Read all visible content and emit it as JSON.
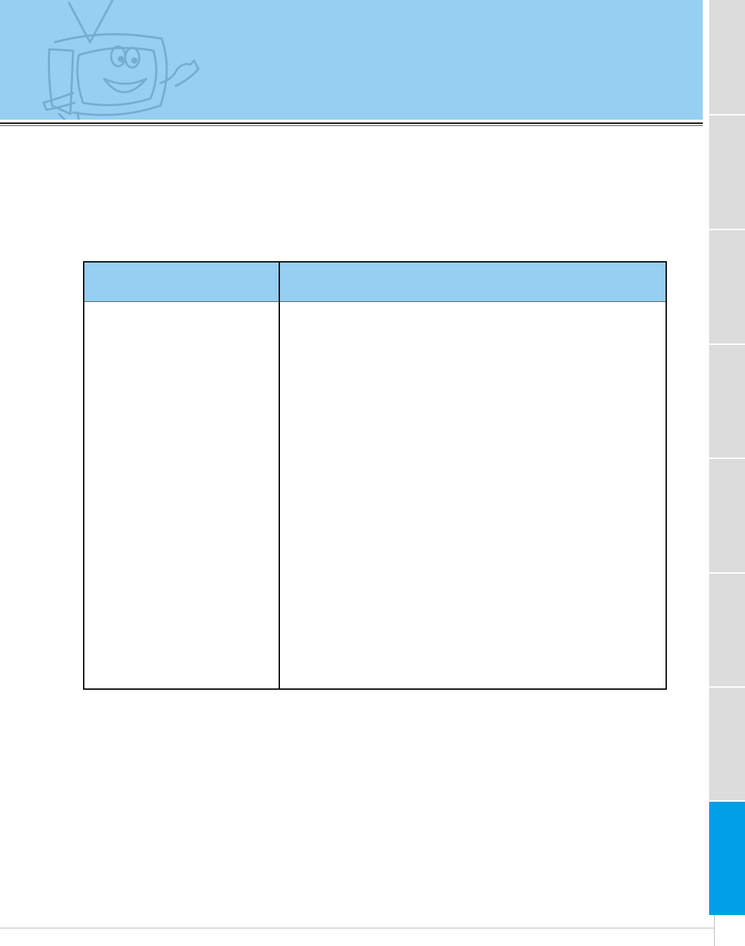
{
  "header": {
    "mascot_icon": "tv-mascot-icon",
    "banner_color": "#97cff2"
  },
  "table": {
    "header_color": "#97cff2",
    "columns": [
      "",
      ""
    ],
    "rows": [
      [
        "",
        ""
      ]
    ]
  },
  "side_tabs": {
    "count": 8,
    "active_index": 7,
    "inactive_color": "#dcdcdc",
    "active_color": "#00a0e9"
  }
}
